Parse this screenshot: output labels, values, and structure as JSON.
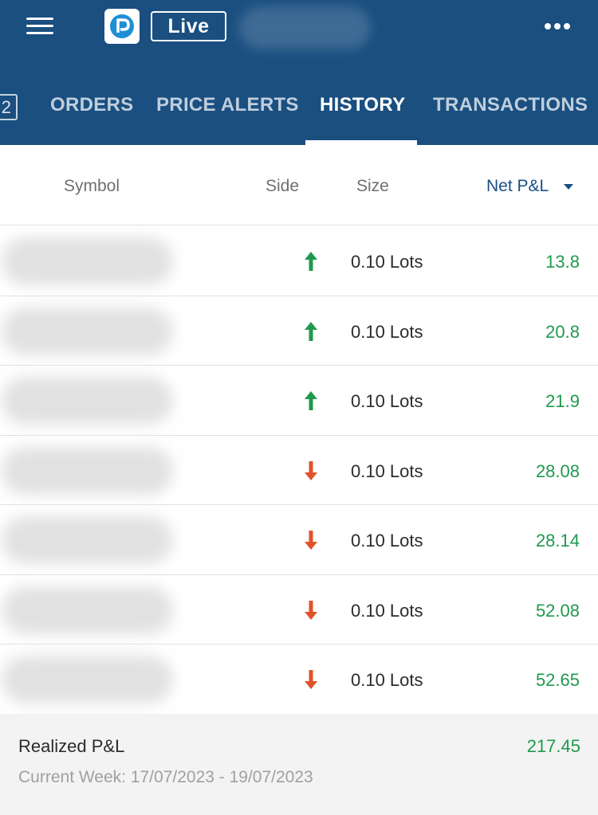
{
  "header": {
    "live_label": "Live",
    "brand_color": "#1a4f80"
  },
  "tabs": {
    "badge_count": "2",
    "items": [
      {
        "label": "ORDERS",
        "active": false
      },
      {
        "label": "PRICE ALERTS",
        "active": false
      },
      {
        "label": "HISTORY",
        "active": true
      },
      {
        "label": "TRANSACTIONS",
        "active": false
      }
    ]
  },
  "columns": {
    "symbol": "Symbol",
    "side": "Side",
    "size": "Size",
    "net_pnl": "Net P&L"
  },
  "rows": [
    {
      "side": "buy",
      "size": "0.10 Lots",
      "pnl": "13.8"
    },
    {
      "side": "buy",
      "size": "0.10 Lots",
      "pnl": "20.8"
    },
    {
      "side": "buy",
      "size": "0.10 Lots",
      "pnl": "21.9"
    },
    {
      "side": "sell",
      "size": "0.10 Lots",
      "pnl": "28.08"
    },
    {
      "side": "sell",
      "size": "0.10 Lots",
      "pnl": "28.14"
    },
    {
      "side": "sell",
      "size": "0.10 Lots",
      "pnl": "52.08"
    },
    {
      "side": "sell",
      "size": "0.10 Lots",
      "pnl": "52.65"
    }
  ],
  "footer": {
    "realized_label": "Realized P&L",
    "realized_value": "217.45",
    "week_range": "Current Week: 17/07/2023 - 19/07/2023"
  },
  "colors": {
    "positive": "#1f9a4d",
    "buy_arrow": "#1f9a4d",
    "sell_arrow": "#e0532a"
  }
}
